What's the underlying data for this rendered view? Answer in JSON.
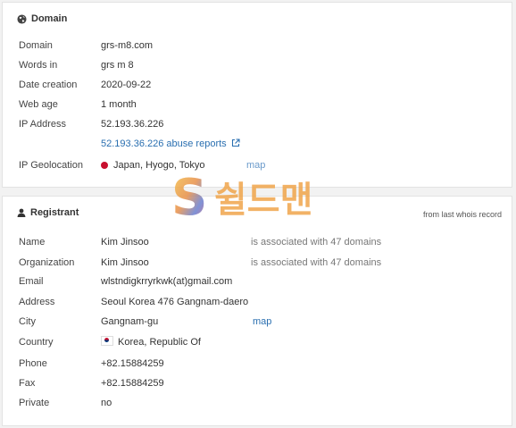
{
  "domain_panel": {
    "title": "Domain",
    "rows": {
      "domain": {
        "label": "Domain",
        "value": "grs-m8.com"
      },
      "words_in": {
        "label": "Words in",
        "value": "grs m 8"
      },
      "date_creation": {
        "label": "Date creation",
        "value": "2020-09-22"
      },
      "web_age": {
        "label": "Web age",
        "value": "1 month"
      },
      "ip_address": {
        "label": "IP Address",
        "value": "52.193.36.226"
      },
      "abuse_reports": {
        "value": "52.193.36.226 abuse reports"
      },
      "ip_geolocation": {
        "label": "IP Geolocation",
        "value": "Japan, Hyogo, Tokyo",
        "map": "map"
      }
    }
  },
  "registrant_panel": {
    "title": "Registrant",
    "note": "from last whois record",
    "rows": {
      "name": {
        "label": "Name",
        "value": "Kim Jinsoo",
        "assoc": "is associated with 47 domains"
      },
      "organization": {
        "label": "Organization",
        "value": "Kim Jinsoo",
        "assoc": "is associated with 47 domains"
      },
      "email": {
        "label": "Email",
        "value": "wlstndigkrryrkwk(at)gmail.com"
      },
      "address": {
        "label": "Address",
        "value": "Seoul Korea 476 Gangnam-daero"
      },
      "city": {
        "label": "City",
        "value": "Gangnam-gu",
        "map": "map"
      },
      "country": {
        "label": "Country",
        "value": "Korea, Republic Of"
      },
      "phone": {
        "label": "Phone",
        "value": "+82.15884259"
      },
      "fax": {
        "label": "Fax",
        "value": "+82.15884259"
      },
      "private": {
        "label": "Private",
        "value": "no"
      }
    }
  },
  "watermark": {
    "letter": "S",
    "text": "쉴드맨"
  },
  "icons": {
    "globe": "globe-icon",
    "user": "user-icon",
    "external": "external-link-icon",
    "flag_jp": "japan-flag-icon",
    "flag_kr": "korea-flag-icon"
  },
  "colors": {
    "link": "#2a6fb0",
    "watermark_orange": "#f0a040"
  }
}
